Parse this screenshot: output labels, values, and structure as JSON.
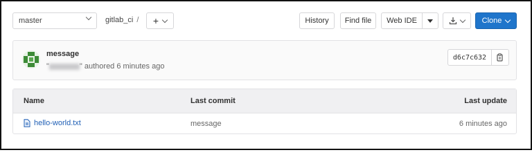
{
  "toolbar": {
    "branch": "master",
    "path": "gitlab_ci",
    "separator": "/",
    "add_label": "+",
    "history": "History",
    "find_file": "Find file",
    "web_ide": "Web IDE",
    "clone": "Clone"
  },
  "commit": {
    "message": "message",
    "author_quote_open": "\"",
    "author_quote_close": "\"",
    "authored_text": "authored 6 minutes ago",
    "sha": "d6c7c632"
  },
  "table": {
    "headers": [
      "Name",
      "Last commit",
      "Last update"
    ],
    "rows": [
      {
        "name": "hello-world.txt",
        "last_commit": "message",
        "last_update": "6 minutes ago"
      }
    ]
  },
  "colors": {
    "accent": "#1f75cb",
    "link": "#1f5fb5",
    "header_bg": "#f0f0f2",
    "avatar": "#3d8b37"
  }
}
